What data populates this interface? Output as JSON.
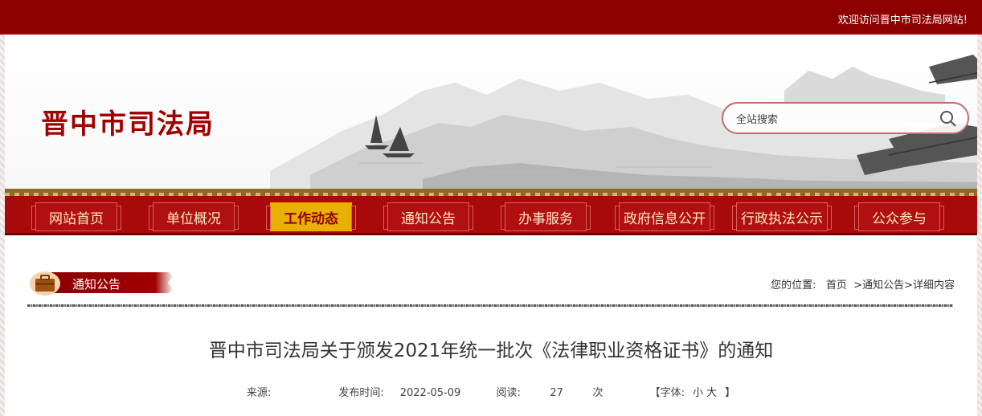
{
  "topbar": {
    "welcome": "欢迎访问晋中市司法局网站!"
  },
  "header": {
    "site_title": "晋中市司法局"
  },
  "search": {
    "placeholder": "全站搜索"
  },
  "nav": {
    "items": [
      {
        "label": "网站首页"
      },
      {
        "label": "单位概况"
      },
      {
        "label": "工作动态"
      },
      {
        "label": "通知公告"
      },
      {
        "label": "办事服务"
      },
      {
        "label": "政府信息公开"
      },
      {
        "label": "行政执法公示"
      },
      {
        "label": "公众参与"
      }
    ],
    "active_index": 2
  },
  "section": {
    "label": "通知公告"
  },
  "breadcrumb": {
    "prefix": "您的位置:",
    "home": "首页",
    "sep1": ">",
    "category": "通知公告",
    "sep2": ">",
    "current": "详细内容"
  },
  "article": {
    "title": "晋中市司法局关于颁发2021年统一批次《法律职业资格证书》的通知",
    "source_label": "来源:",
    "source_value": "",
    "date_label": "发布时间:",
    "date_value": "2022-05-09",
    "views_label": "阅读:",
    "views_value": "27",
    "views_unit": "次",
    "font_label": "【字体:",
    "font_small": "小",
    "font_large": "大",
    "font_close": "】"
  },
  "colors": {
    "brand_red": "#8c0000",
    "nav_red": "#a80a0a",
    "active_gold": "#e9b000"
  }
}
